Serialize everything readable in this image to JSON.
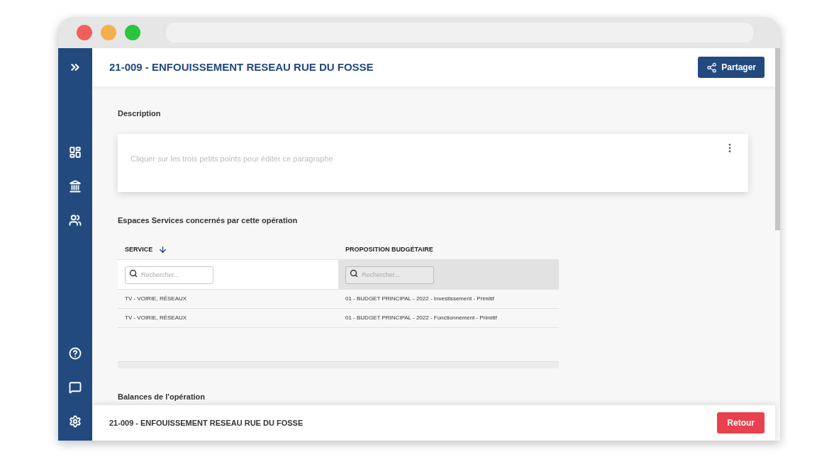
{
  "header": {
    "title": "21-009 - ENFOUISSEMENT RESEAU RUE DU FOSSE",
    "share_button": "Partager"
  },
  "sidebar": {
    "items": [
      {
        "kind": "expand"
      },
      {
        "kind": "dashboard"
      },
      {
        "kind": "bank"
      },
      {
        "kind": "users"
      },
      {
        "kind": "help"
      },
      {
        "kind": "chat"
      },
      {
        "kind": "settings"
      }
    ]
  },
  "description": {
    "title": "Description",
    "empty_text": "Cliquer sur les trois petits points pour éditer ce paragraphe"
  },
  "services": {
    "title": "Espaces Services concernés par cette opération",
    "columns": [
      {
        "label": "SERVICE",
        "sorted": true,
        "highlighted": false,
        "search_placeholder": "Rechercher..."
      },
      {
        "label": "PROPOSITION BUDGÉTAIRE",
        "sorted": false,
        "highlighted": true,
        "search_placeholder": "Rechercher..."
      }
    ],
    "rows": [
      [
        "TV - VOIRIE, RÉSEAUX",
        "01 - BUDGET PRINCIPAL - 2022 - Investissement - Primitif"
      ],
      [
        "TV - VOIRIE, RÉSEAUX",
        "01 - BUDGET PRINCIPAL - 2022 - Fonctionnement - Primitif"
      ]
    ]
  },
  "balances": {
    "title": "Balances de l'opération"
  },
  "footer": {
    "title": "21-009 - ENFOUISSEMENT RESEAU RUE DU FOSSE",
    "back_button": "Retour"
  }
}
